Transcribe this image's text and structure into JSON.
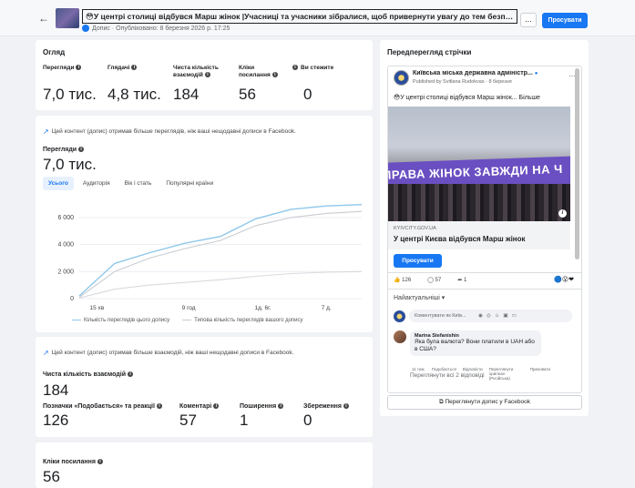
{
  "header": {
    "back": "←",
    "title": "😳У центрі столиці відбувся Марш жінок |Учасниці та учасники зібралися, щоб привернути увагу до тем безпеки, рівн...",
    "meta": "Допис · Опубліковано: 8 березня 2026 р. 17:25",
    "more": "...",
    "promote": "Просувати"
  },
  "overview": {
    "heading": "Огляд",
    "metrics": [
      {
        "label": "Перегляди",
        "value": "7,0 тис."
      },
      {
        "label": "Глядачі",
        "value": "4,8 тис."
      },
      {
        "label": "Чиста кількість взаємодій",
        "value": "184"
      },
      {
        "label": "Кліки посилання",
        "value": "56"
      },
      {
        "label": "Ви стежите",
        "value": "0"
      }
    ]
  },
  "views_card": {
    "notice": "Цей контент (допис) отримав більше переглядів, ніж ваші нещодавні дописи в Facebook.",
    "label": "Перегляди",
    "value": "7,0 тис.",
    "tabs": [
      "Усього",
      "Аудиторія",
      "Вік і стать",
      "Популярні країни"
    ],
    "legend": [
      "Кількість переглядів цього допису",
      "Типова кількість переглядів вашого допису"
    ]
  },
  "chart_data": {
    "type": "line",
    "x_ticks": [
      "15 хв",
      "9 год",
      "1д. 6г.",
      "7 д."
    ],
    "y_ticks": [
      "0",
      "2 000",
      "4 000",
      "6 000"
    ],
    "ylim": [
      0,
      7000
    ],
    "series": [
      {
        "name": "Кількість переглядів цього допису",
        "color": "#8fc7ea",
        "x": [
          0,
          0.5,
          1,
          1.5,
          2,
          2.5,
          3,
          3.5,
          4
        ],
        "values": [
          200,
          2600,
          3400,
          4100,
          4600,
          5900,
          6600,
          6850,
          6950
        ]
      },
      {
        "name": "Типова кількість переглядів вашого допису",
        "color": "#c9ccd1",
        "x": [
          0,
          0.5,
          1,
          1.5,
          2,
          2.5,
          3,
          3.5,
          4
        ],
        "values": [
          100,
          2000,
          3000,
          3700,
          4300,
          5400,
          6000,
          6300,
          6450
        ]
      },
      {
        "name": "",
        "color": "#d8dadf",
        "x": [
          0,
          0.5,
          1,
          1.5,
          2,
          2.5,
          3,
          3.5,
          4
        ],
        "values": [
          50,
          700,
          1000,
          1200,
          1400,
          1650,
          1850,
          1950,
          2000
        ]
      }
    ]
  },
  "interactions_card": {
    "notice": "Цей контент (допис) отримав більше взаємодій, ніж ваші нещодавні дописи в Facebook.",
    "label": "Чиста кількість взаємодій",
    "value": "184",
    "metrics": [
      {
        "label": "Позначки «Подобається» та реакції",
        "value": "126"
      },
      {
        "label": "Коментарі",
        "value": "57"
      },
      {
        "label": "Поширення",
        "value": "1"
      },
      {
        "label": "Збереження",
        "value": "0"
      }
    ]
  },
  "clicks_card": {
    "label": "Кліки посилання",
    "value": "56"
  },
  "preview": {
    "heading": "Передперегляд стрічки",
    "page_name": "Київська міська державна адміністр...",
    "published": "Published by Svitlana Rudokvas · 8 березня",
    "post_text": "😳У центрі столиці відбувся Марш жінок... Більше",
    "banner_text": "ПРАВА ЖІНОК ЗАВЖДИ НА Ч",
    "domain": "KYIVCITY.GOV.UA",
    "link_title": "У центрі Києва відбувся Марш жінок",
    "cta": "Просувати",
    "likes": "126",
    "comments": "57",
    "shares": "1",
    "sort": "Найактуальніші",
    "composer_placeholder": "Коментувати як Київ...",
    "comment": {
      "name": "Marina Stefanishin",
      "text": "Яка була валюта? Вони платили в UAH або в США?",
      "actions": [
        "11 тиж.",
        "Подобається",
        "Відповісти",
        "Переглянути оригінал (Російська)",
        "Приховати"
      ]
    },
    "view_replies": "Переглянути всі 2 відповіді",
    "view_on_fb": "Переглянути допис у Facebook"
  }
}
